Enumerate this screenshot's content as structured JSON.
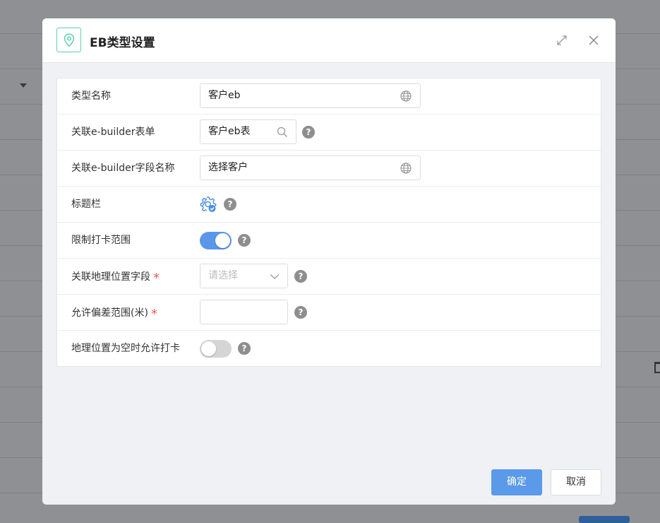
{
  "dialog": {
    "title": "EB类型设置",
    "header_icon": "location-pin-icon",
    "accent_color": "#5fcfa9"
  },
  "form": {
    "type_name": {
      "label": "类型名称",
      "value": "客户eb",
      "icon": "globe-icon"
    },
    "eb_form": {
      "label": "关联e-builder表单",
      "value": "客户eb表",
      "icon": "search-icon",
      "help": "?"
    },
    "eb_field_name": {
      "label": "关联e-builder字段名称",
      "value": "选择客户",
      "icon": "globe-icon"
    },
    "title_bar": {
      "label": "标题栏",
      "icon": "gear-check-icon",
      "help": "?"
    },
    "limit_range": {
      "label": "限制打卡范围",
      "enabled": true,
      "help": "?"
    },
    "geo_field": {
      "label": "关联地理位置字段",
      "required_mark": "*",
      "placeholder": "请选择",
      "icon": "chevron-down-icon",
      "help": "?"
    },
    "deviation": {
      "label": "允许偏差范围(米)",
      "required_mark": "*",
      "value": "",
      "help": "?"
    },
    "allow_empty_geo": {
      "label": "地理位置为空时允许打卡",
      "enabled": false,
      "help": "?"
    }
  },
  "footer": {
    "confirm_label": "确定",
    "cancel_label": "取消",
    "primary_color": "#5a9ae8"
  }
}
